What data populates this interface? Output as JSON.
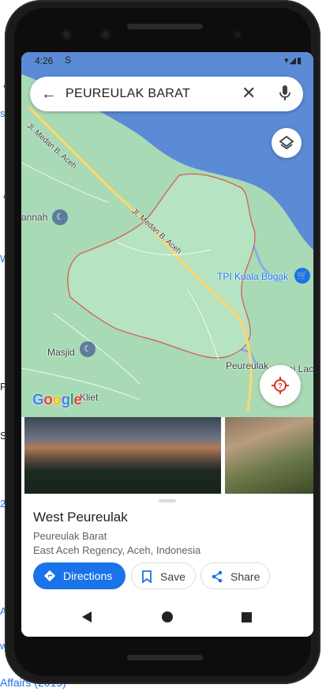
{
  "background": {
    "texts": [
      "annah",
      "s",
      "W",
      "Pr",
      "S",
      "2",
      "A",
      "w",
      "Affairs (2019)"
    ]
  },
  "status_bar": {
    "time": "4:26",
    "signal_glyph": "S",
    "right_icons": [
      "wifi-icon",
      "cell-signal-icon",
      "battery-icon"
    ]
  },
  "search": {
    "query": "PEUREULAK BARAT",
    "back_icon": "arrow-back-icon",
    "clear_icon": "close-icon",
    "mic_icon": "mic-icon"
  },
  "map": {
    "labels": {
      "road1": "Jl. Medan B. Aceh",
      "road2": "Jl. Medan B. Aceh",
      "poi_tpi": "TPI Kuala Bugak",
      "poi_masjid": "Masjid",
      "town": "Peureulak",
      "town_partial": "ai Lac",
      "annah": "annah",
      "kliet": "Kliet"
    },
    "logo": "Google",
    "colors": {
      "land": "#a8dab5",
      "water": "#5b8bd6",
      "road": "#f7d774",
      "boundary": "#d9534f"
    }
  },
  "place": {
    "title": "West Peureulak",
    "subtitle": "Peureulak Barat",
    "address": "East Aceh Regency, Aceh, Indonesia"
  },
  "actions": {
    "directions": "Directions",
    "save": "Save",
    "share": "Share"
  },
  "accent_color": "#1a73e8"
}
